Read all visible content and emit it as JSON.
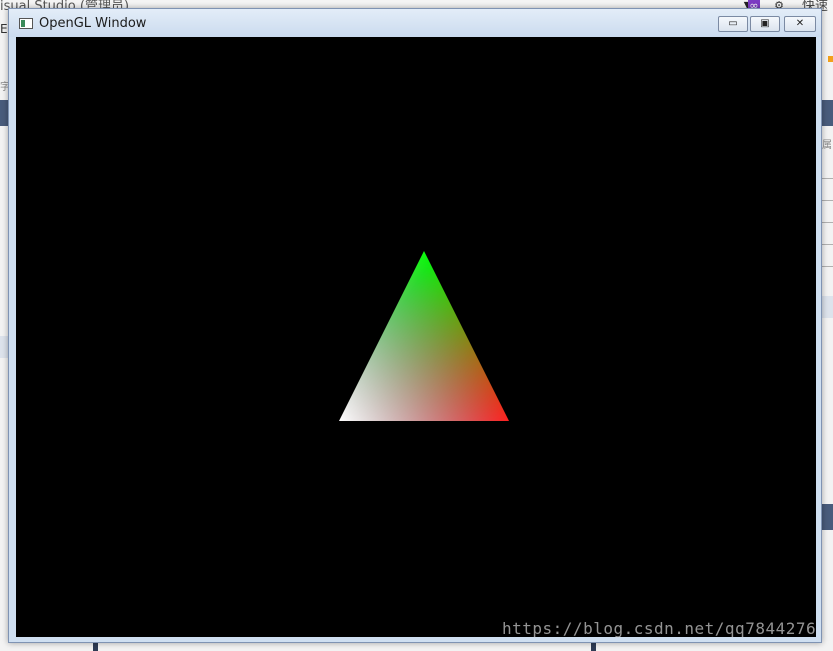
{
  "background_app": {
    "title_fragment": "isual Studio (管理员)",
    "right_text": "快速启",
    "left_glyph": "E",
    "left_fragment": "字",
    "right_fragment": "属"
  },
  "window": {
    "title": "OpenGL Window",
    "controls": {
      "minimize": "▭",
      "maximize": "▣",
      "close": "✕"
    }
  },
  "scene": {
    "background_color": "#000000",
    "vertices": [
      {
        "name": "top",
        "color": "#00ff00"
      },
      {
        "name": "bottom-left",
        "color": "#ffffff"
      },
      {
        "name": "bottom-right",
        "color": "#ff0000"
      }
    ]
  },
  "watermark": {
    "text": "https://blog.csdn.net/qq7844276"
  }
}
